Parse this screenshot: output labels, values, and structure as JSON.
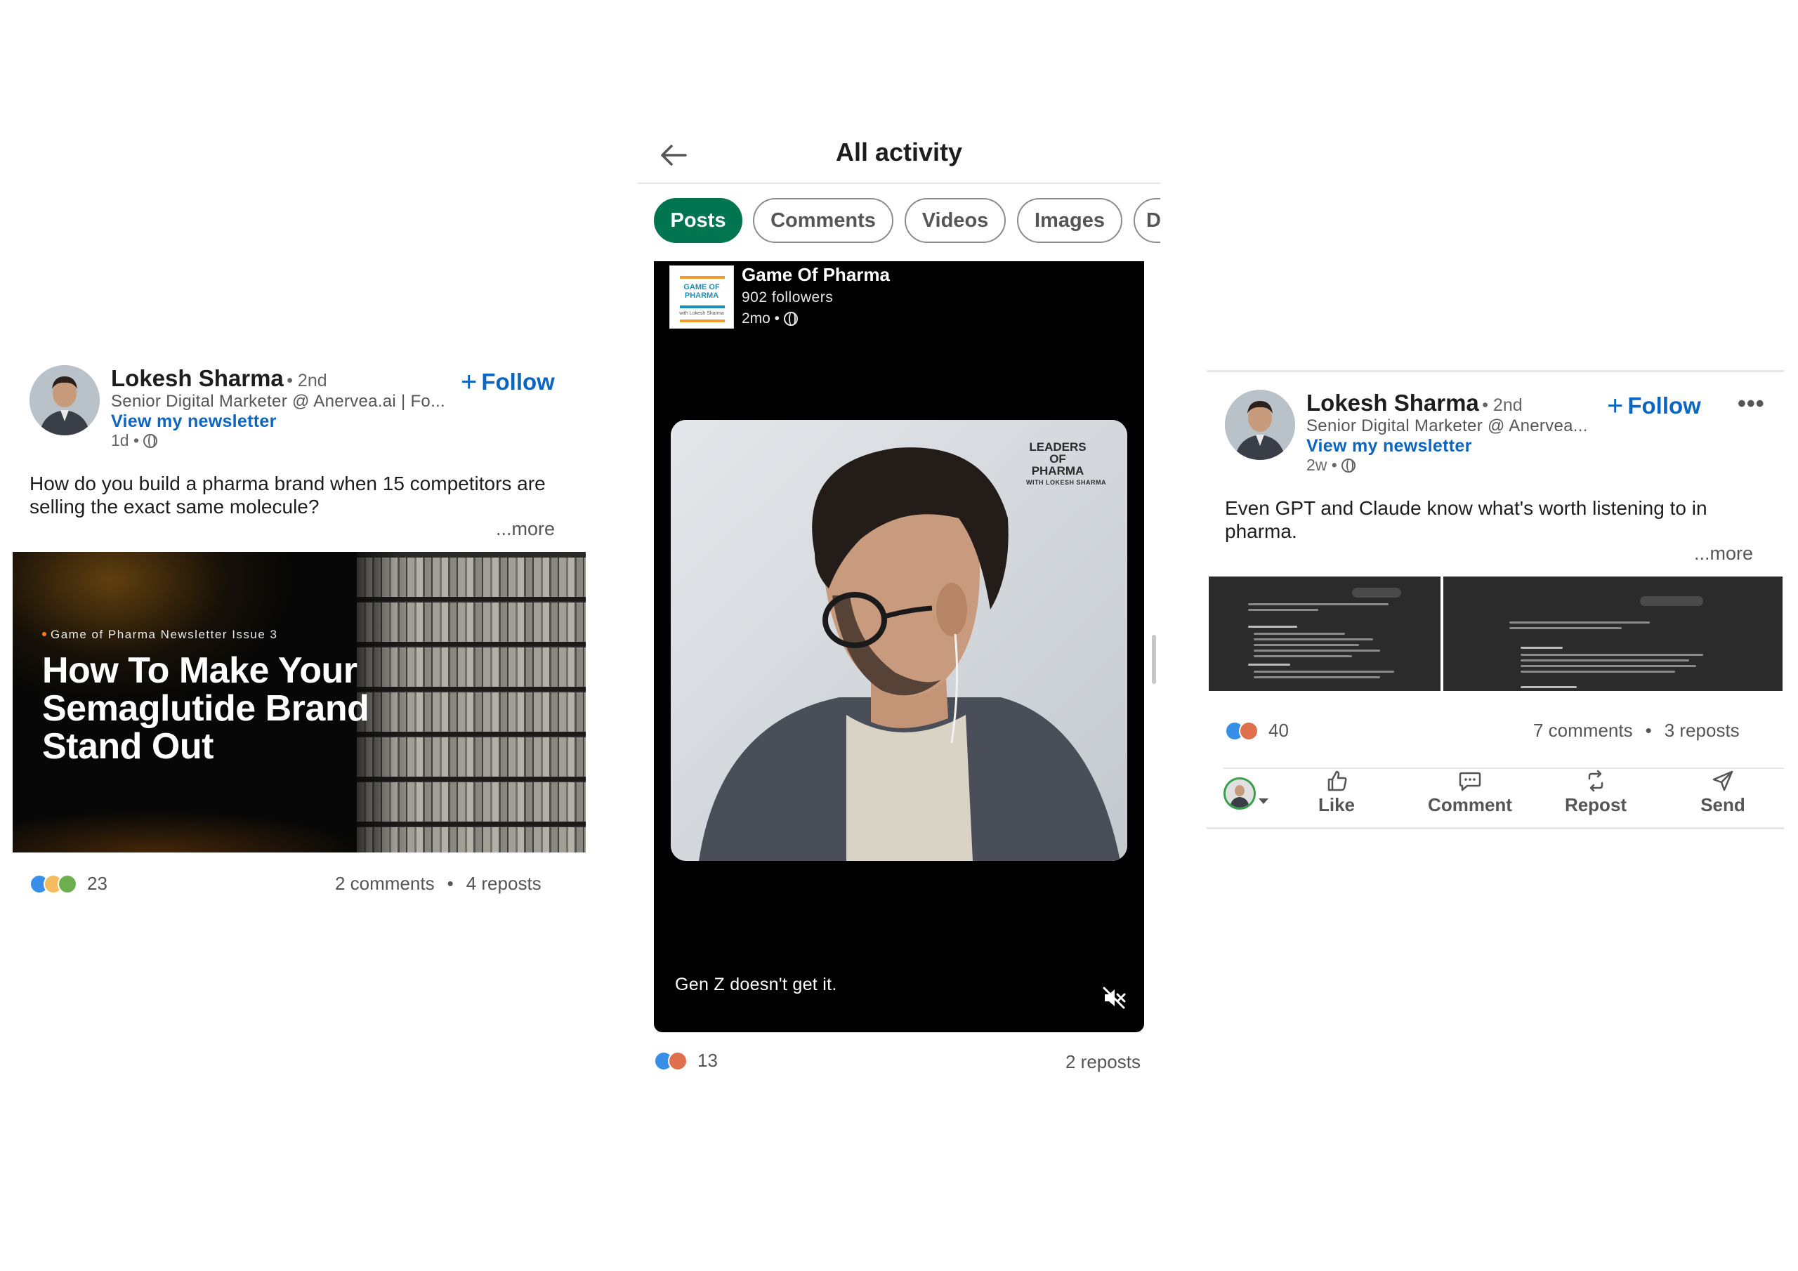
{
  "left_post": {
    "author": "Lokesh Sharma",
    "degree": "• 2nd",
    "follow_label": "Follow",
    "headline": "Senior Digital Marketer @ Anervea.ai | Fo...",
    "newsletter_link": "View my newsletter",
    "time": "1d •",
    "text": "How do you build a pharma brand when 15 competitors are selling the exact same molecule?",
    "more_label": "...more",
    "media": {
      "kicker": "Game of Pharma Newsletter Issue 3",
      "title": "How To Make Your Semaglutide Brand Stand Out"
    },
    "reaction_count": "23",
    "comments": "2 comments",
    "separator": "•",
    "reposts": "4 reposts"
  },
  "center_panel": {
    "title": "All activity",
    "filters": [
      {
        "label": "Posts",
        "active": true
      },
      {
        "label": "Comments",
        "active": false
      },
      {
        "label": "Videos",
        "active": false
      },
      {
        "label": "Images",
        "active": false
      },
      {
        "label": "D",
        "active": false
      }
    ],
    "video_post": {
      "page_name": "Game Of Pharma",
      "followers": "902 followers",
      "time": "2mo •",
      "logo_text": "GAME OF PHARMA",
      "logo_subtext": "with Lokesh Sharma",
      "video_logo": "LEADERS OF PHARMA",
      "video_logo_sub": "WITH LOKESH SHARMA",
      "caption": "Gen Z doesn't get it.",
      "reaction_count": "13",
      "reposts": "2 reposts"
    }
  },
  "right_post": {
    "author": "Lokesh Sharma",
    "degree": "• 2nd",
    "follow_label": "Follow",
    "headline": "Senior Digital Marketer @ Anervea...",
    "newsletter_link": "View my newsletter",
    "time": "2w •",
    "text": "Even GPT and Claude know what's worth listening to in pharma.",
    "more_label": "...more",
    "reaction_count": "40",
    "comments": "7 comments",
    "separator": "•",
    "reposts": "3 reposts",
    "actions": {
      "like": "Like",
      "comment": "Comment",
      "repost": "Repost",
      "send": "Send"
    }
  },
  "colors": {
    "linkedin_blue": "#0a66c2",
    "active_chip": "#01754f",
    "text_primary": "#1d1d1d",
    "text_secondary": "#555555"
  }
}
